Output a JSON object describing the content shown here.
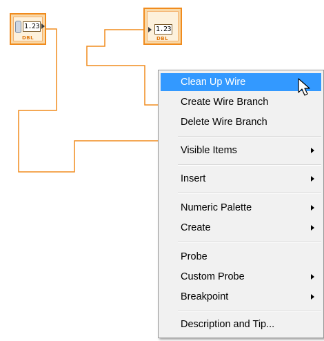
{
  "diagram": {
    "control_terminal": {
      "value": "1.23",
      "type": "DBL"
    },
    "indicator_terminal": {
      "value": "1.23",
      "type": "DBL"
    },
    "colors": {
      "wire": "#f08b1d",
      "highlight": "#3399ff",
      "menu_bg": "#f1f1f1"
    }
  },
  "context_menu": {
    "items": [
      {
        "label": "Clean Up Wire",
        "highlighted": true,
        "submenu": false
      },
      {
        "label": "Create Wire Branch",
        "submenu": false
      },
      {
        "label": "Delete Wire Branch",
        "submenu": false
      },
      {
        "label": "Visible Items",
        "submenu": true
      },
      {
        "label": "Insert",
        "submenu": true
      },
      {
        "label": "Numeric Palette",
        "submenu": true
      },
      {
        "label": "Create",
        "submenu": true
      },
      {
        "label": "Probe",
        "submenu": false
      },
      {
        "label": "Custom Probe",
        "submenu": true
      },
      {
        "label": "Breakpoint",
        "submenu": true
      },
      {
        "label": "Description and Tip...",
        "submenu": false
      }
    ]
  },
  "cursor": {
    "icon": "arrow-pointer-icon"
  }
}
